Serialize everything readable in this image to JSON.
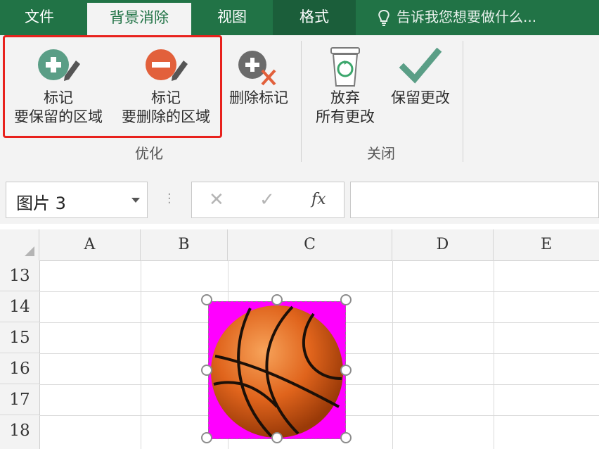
{
  "tabs": [
    {
      "label": "文件"
    },
    {
      "label": "背景消除"
    },
    {
      "label": "视图"
    },
    {
      "label": "格式"
    }
  ],
  "tell_me": "告诉我您想要做什么...",
  "ribbon": {
    "groups": {
      "refine": "优化",
      "close": "关闭"
    },
    "buttons": {
      "mark_keep_line1": "标记",
      "mark_keep_line2": "要保留的区域",
      "mark_remove_line1": "标记",
      "mark_remove_line2": "要删除的区域",
      "delete_mark": "删除标记",
      "discard_line1": "放弃",
      "discard_line2": "所有更改",
      "keep_changes": "保留更改"
    }
  },
  "formula_bar": {
    "name_box": "图片 3",
    "cancel_symbol": "✕",
    "enter_symbol": "✓",
    "fx_label": "fx",
    "value": ""
  },
  "sheet": {
    "columns": [
      "A",
      "B",
      "C",
      "D",
      "E"
    ],
    "rows": [
      "13",
      "14",
      "15",
      "16",
      "17",
      "18"
    ]
  },
  "colors": {
    "ribbon_green": "#217346",
    "highlight_red": "#e8211c",
    "removal_magenta": "#ff00ff"
  },
  "icons": [
    "plus-pen-icon",
    "minus-pen-icon",
    "delete-mark-icon",
    "recycle-bin-icon",
    "checkmark-icon",
    "lightbulb-icon"
  ]
}
